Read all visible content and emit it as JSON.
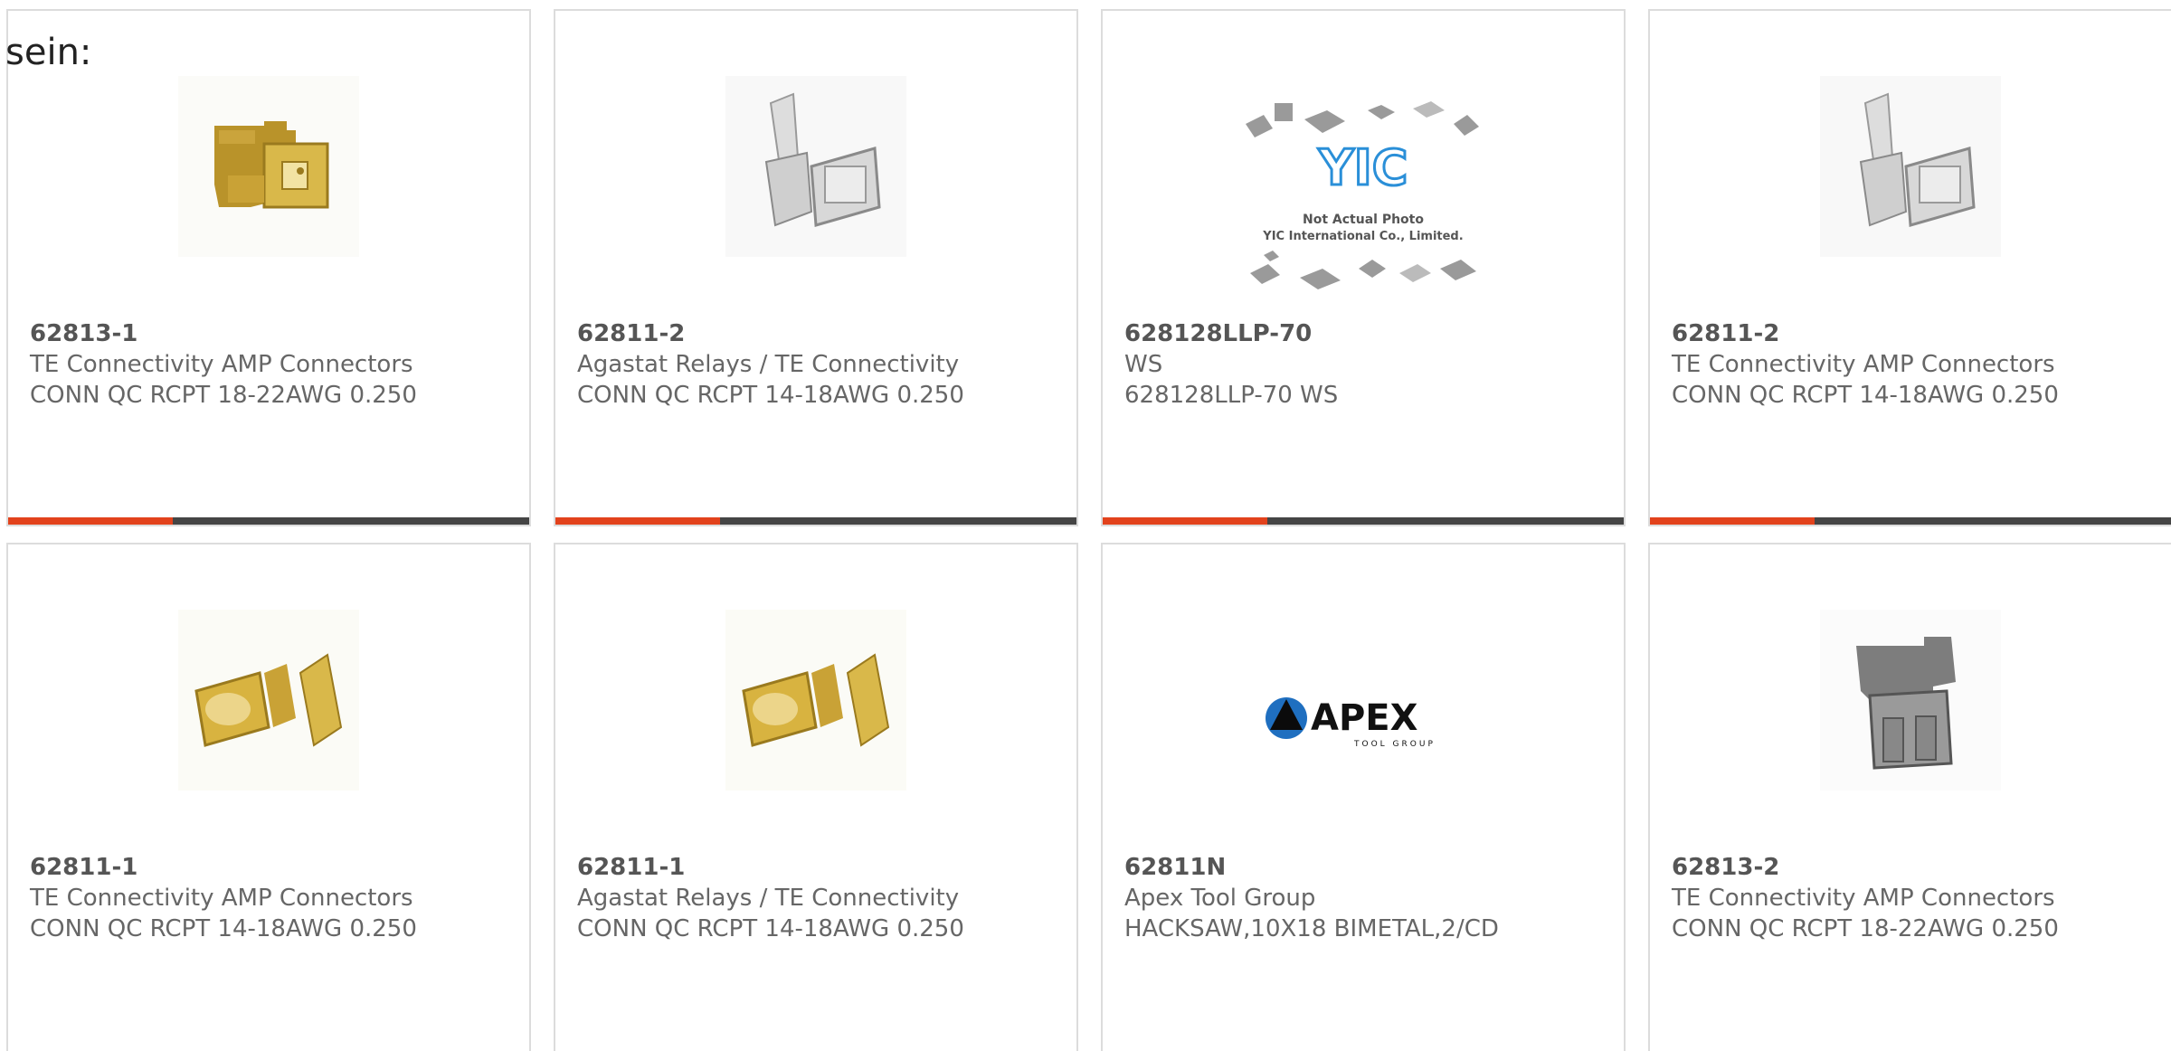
{
  "intro_text": "sein:",
  "colors": {
    "accent": "#e2421c",
    "bar": "#454545",
    "border": "#dcdcdc",
    "text": "#666666"
  },
  "products": [
    {
      "part": "62813-1",
      "maker": "TE Connectivity AMP Connectors",
      "desc": "CONN QC RCPT 18-22AWG 0.250",
      "image": "gold-flag-terminal"
    },
    {
      "part": "62811-2",
      "maker": "Agastat Relays / TE Connectivity",
      "desc": "CONN QC RCPT 14-18AWG 0.250",
      "image": "silver-flag-terminal"
    },
    {
      "part": "628128LLP-70",
      "maker": "WS",
      "desc": "628128LLP-70 WS",
      "image": "yic-placeholder",
      "placeholder_lines": [
        "YIC",
        "Not Actual Photo",
        "YIC International Co., Limited."
      ]
    },
    {
      "part": "62811-2",
      "maker": "TE Connectivity AMP Connectors",
      "desc": "CONN QC RCPT 14-18AWG 0.250",
      "image": "silver-flag-terminal"
    },
    {
      "part": "62811-1",
      "maker": "TE Connectivity AMP Connectors",
      "desc": "CONN QC RCPT 14-18AWG 0.250",
      "image": "gold-flag-terminal-tab"
    },
    {
      "part": "62811-1",
      "maker": "Agastat Relays / TE Connectivity",
      "desc": "CONN QC RCPT 14-18AWG 0.250",
      "image": "gold-flag-terminal-tab"
    },
    {
      "part": "62811N",
      "maker": "Apex Tool Group",
      "desc": "HACKSAW,10X18 BIMETAL,2/CD",
      "image": "apex-logo",
      "logo_lines": [
        "APEX",
        "TOOL GROUP"
      ]
    },
    {
      "part": "62813-2",
      "maker": "TE Connectivity AMP Connectors",
      "desc": "CONN QC RCPT 18-22AWG 0.250",
      "image": "grey-flag-terminal"
    }
  ]
}
